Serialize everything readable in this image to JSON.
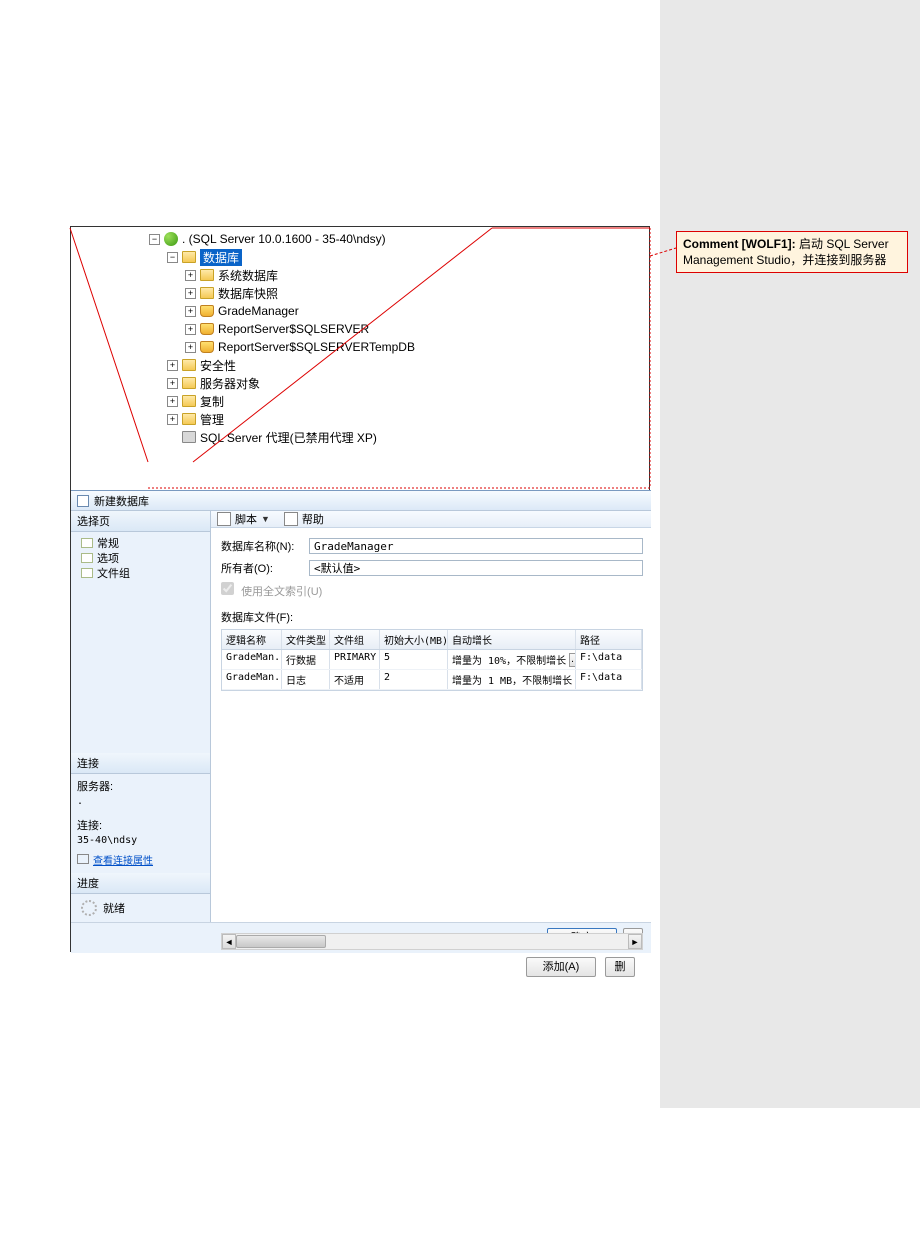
{
  "tree": {
    "root": ". (SQL Server 10.0.1600 - 35-40\\ndsy)",
    "databases": "数据库",
    "sys_db": "系统数据库",
    "snapshot": "数据库快照",
    "db1": "GradeManager",
    "db2": "ReportServer$SQLSERVER",
    "db3": "ReportServer$SQLSERVERTempDB",
    "security": "安全性",
    "server_obj": "服务器对象",
    "replication": "复制",
    "management": "管理",
    "agent": "SQL Server 代理(已禁用代理 XP)"
  },
  "dialog": {
    "title": "新建数据库",
    "left": {
      "select_page": "选择页",
      "general": "常规",
      "options": "选项",
      "filegroups": "文件组",
      "connection": "连接",
      "server": "服务器:",
      "server_val": ".",
      "conn": "连接:",
      "conn_val": "35-40\\ndsy",
      "view_conn": "查看连接属性",
      "progress": "进度",
      "ready": "就绪"
    },
    "toolbar": {
      "script": "脚本",
      "help": "帮助"
    },
    "form": {
      "dbname_label": "数据库名称(N):",
      "dbname_value": "GradeManager",
      "owner_label": "所有者(O):",
      "owner_value": "<默认值>",
      "fulltext": "使用全文索引(U)",
      "files_label": "数据库文件(F):"
    },
    "grid": {
      "headers": {
        "name": "逻辑名称",
        "type": "文件类型",
        "group": "文件组",
        "size": "初始大小(MB)",
        "grow": "自动增长",
        "path": "路径"
      },
      "rows": [
        {
          "name": "GradeMan...",
          "type": "行数据",
          "group": "PRIMARY",
          "size": "5",
          "grow": "增量为 10%，不限制增长",
          "path": "F:\\data"
        },
        {
          "name": "GradeMan...",
          "type": "日志",
          "group": "不适用",
          "size": "2",
          "grow": "增量为 1 MB，不限制增长",
          "path": "F:\\data"
        }
      ]
    },
    "buttons": {
      "add": "添加(A)",
      "delete": "删",
      "ok": "确定"
    }
  },
  "comment": {
    "label": "Comment [WOLF1]:",
    "text": "启动 SQL Server Management Studio，并连接到服务器"
  }
}
